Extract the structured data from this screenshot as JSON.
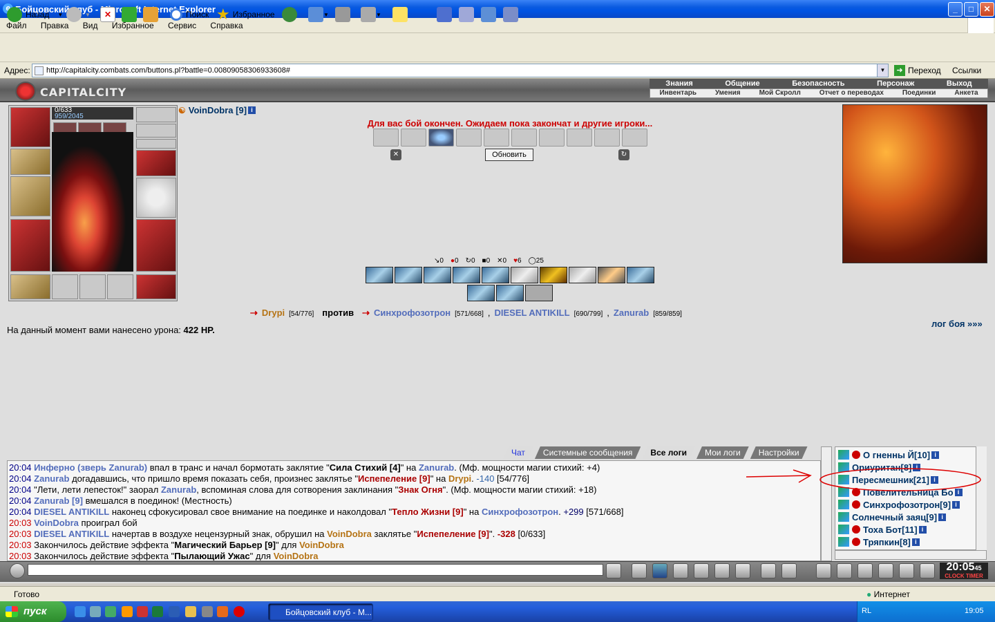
{
  "window": {
    "title": "Бойцовский клуб - Microsoft Internet Explorer"
  },
  "menu": [
    "Файл",
    "Правка",
    "Вид",
    "Избранное",
    "Сервис",
    "Справка"
  ],
  "toolbar": {
    "back": "Назад",
    "search": "Поиск",
    "favorites": "Избранное"
  },
  "address": {
    "label": "Адрес:",
    "url": "http://capitalcity.combats.com/buttons.pl?battle=0.00809058306933608#",
    "go": "Переход",
    "links": "Ссылки"
  },
  "game": {
    "logo": "CAPITALCITY",
    "topnav": [
      "Знания",
      "Общение",
      "Безопасность",
      "Персонаж",
      "Выход"
    ],
    "subnav": [
      "Инвентарь",
      "Умения",
      "Мой Скролл",
      "Отчет о переводах",
      "Поединки",
      "Анкета"
    ],
    "player": {
      "name": "VoinDobra [9]",
      "hp": "0/633",
      "hp_fill": 0,
      "mana": "959/2045",
      "mana_fill": 0.47
    },
    "battle_message": "Для вас бой окончен. Ожидаем пока закончат и другие игроки...",
    "refresh": "Обновить",
    "stats": [
      "0",
      "0",
      "0",
      "0",
      "0",
      "6",
      "25"
    ],
    "vs": {
      "left": [
        {
          "name": "Drypi",
          "hp": "[54/776]"
        }
      ],
      "against": "против",
      "right": [
        {
          "name": "Синхрофозотрон",
          "hp": "[571/668]"
        },
        {
          "name": "DIESEL ANTIKILL",
          "hp": "[690/799]"
        },
        {
          "name": "Zanurab",
          "hp": "[859/859]"
        }
      ]
    },
    "damage": {
      "text": "На данный момент вами нанесено урона:",
      "value": "422 HP."
    },
    "log_link": "лог боя »»»"
  },
  "chat": {
    "tabs": [
      "Чат",
      "Системные сообщения",
      "Все логи",
      "Мои логи",
      "Настройки"
    ],
    "lines": [
      {
        "t": "20:04",
        "parts": [
          [
            "nv",
            "Инферно (зверь Zanurab)"
          ],
          [
            "",
            ""
          ],
          [
            "plain",
            " впал в транс и начал бормотать заклятие \""
          ],
          [
            "q",
            "Сила Стихий [4]"
          ],
          [
            "plain",
            "\" на "
          ],
          [
            "nv",
            "Zanurab"
          ],
          [
            "plain",
            ". (Мф. мощности магии стихий: +4)"
          ]
        ]
      },
      {
        "t": "20:04",
        "parts": [
          [
            "nv",
            "Zanurab"
          ],
          [
            "plain",
            " догадавшись, что пришло время показать себя, произнес заклятье \""
          ],
          [
            "nr",
            "Испепеление [9]"
          ],
          [
            "plain",
            "\" на "
          ],
          [
            "no",
            "Drypi"
          ],
          [
            "plain",
            ". "
          ],
          [
            "vb",
            "-140"
          ],
          [
            "plain",
            " [54/776]"
          ]
        ]
      },
      {
        "t": "20:04",
        "parts": [
          [
            "plain",
            "\"Лети, лети лепесток!\" заорал "
          ],
          [
            "nv",
            "Zanurab"
          ],
          [
            "plain",
            ", вспоминая слова для сотворения заклинания \""
          ],
          [
            "nr",
            "Знак Огня"
          ],
          [
            "plain",
            "\". (Мф. мощности магии стихий: +18)"
          ]
        ]
      },
      {
        "t": "20:04",
        "parts": [
          [
            "nv",
            "Zanurab [9]"
          ],
          [
            "plain",
            " вмешался в поединок! (Местность)"
          ]
        ]
      },
      {
        "t": "20:04",
        "parts": [
          [
            "nv",
            "DIESEL ANTIKILL"
          ],
          [
            "plain",
            " наконец сфокусировал свое внимание на поединке и наколдовал \""
          ],
          [
            "nr",
            "Тепло Жизни [9]"
          ],
          [
            "plain",
            "\" на "
          ],
          [
            "nv",
            "Синхрофозотрон"
          ],
          [
            "plain",
            ". "
          ],
          [
            "vt",
            "+299"
          ],
          [
            "plain",
            " [571/668]"
          ]
        ]
      },
      {
        "t": "20:03",
        "parts": [
          [
            "nv",
            "VoinDobra"
          ],
          [
            "plain",
            " проиграл бой"
          ]
        ]
      },
      {
        "t": "20:03",
        "parts": [
          [
            "nv",
            "DIESEL ANTIKILL"
          ],
          [
            "plain",
            " начертав в воздухе нецензурный знак, обрушил на "
          ],
          [
            "no",
            "VoinDobra"
          ],
          [
            "plain",
            " заклятье \""
          ],
          [
            "nr",
            "Испепеление [9]"
          ],
          [
            "plain",
            "\". "
          ],
          [
            "nr",
            "-328"
          ],
          [
            "plain",
            " [0/633]"
          ]
        ]
      },
      {
        "t": "20:03",
        "parts": [
          [
            "plain",
            "Закончилось действие эффекта \""
          ],
          [
            "q",
            "Магический Барьер [9]"
          ],
          [
            "plain",
            "\" для "
          ],
          [
            "no",
            "VoinDobra"
          ]
        ]
      },
      {
        "t": "20:03",
        "parts": [
          [
            "plain",
            "Закончилось действие эффекта \""
          ],
          [
            "q",
            "Пылающий Ужас"
          ],
          [
            "plain",
            "\" для "
          ],
          [
            "no",
            "VoinDobra"
          ]
        ]
      }
    ]
  },
  "users": [
    {
      "name": "О гненны Й",
      "lvl": "[10]"
    },
    {
      "name": "Ориуритан",
      "lvl": "[8]"
    },
    {
      "name": "Пересмешник",
      "lvl": "[21]"
    },
    {
      "name": "Повелительница Бо",
      "lvl": ""
    },
    {
      "name": "Синхрофозотрон",
      "lvl": "[9]"
    },
    {
      "name": "Солнечный заяц",
      "lvl": "[9]"
    },
    {
      "name": "Тоха Бот",
      "lvl": "[11]"
    },
    {
      "name": "Тряпкин",
      "lvl": "[8]"
    }
  ],
  "clock": {
    "time": "20:05",
    "sec": "45",
    "label": "CLOCK TIMER"
  },
  "status": {
    "text": "Готово",
    "zone": "Интернет"
  },
  "taskbar": {
    "start": "пуск",
    "item": "Бойцовский клуб - M...",
    "lang": "RL",
    "time": "19:05"
  }
}
